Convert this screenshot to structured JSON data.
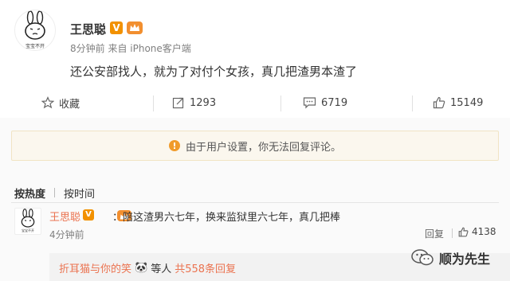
{
  "post": {
    "author": "王思聪",
    "avatar_caption": "宝宝不开",
    "meta": "8分钟前 来自 iPhone客户端",
    "content": "还公安部找人，就为了对付个女孩，真几把渣男本渣了",
    "verified_badge": "V"
  },
  "actions": {
    "favorite": "收藏",
    "repost": "1293",
    "comment": "6719",
    "like": "15149"
  },
  "notice": {
    "icon": "!",
    "text": "由于用户设置，你无法回复评论。"
  },
  "sort": {
    "by_hot": "按热度",
    "by_time": "按时间"
  },
  "comment": {
    "author": "王思聪",
    "text": "：陪这渣男六七年，换来监狱里六七年，真几把棒",
    "time": "4分钟前",
    "reply_label": "回复",
    "likes": "4138",
    "avatar_caption": "宝宝不开",
    "verified_badge": "V"
  },
  "replies": {
    "user": "折耳猫与你的笑",
    "emoji": "🐼",
    "suffix": "等人",
    "count_text": "共558条回复"
  },
  "watermark": {
    "text": "顺为先生"
  },
  "colors": {
    "link": "#eb7350",
    "badge": "#f29100",
    "notice_bg": "#fbf7ee"
  }
}
